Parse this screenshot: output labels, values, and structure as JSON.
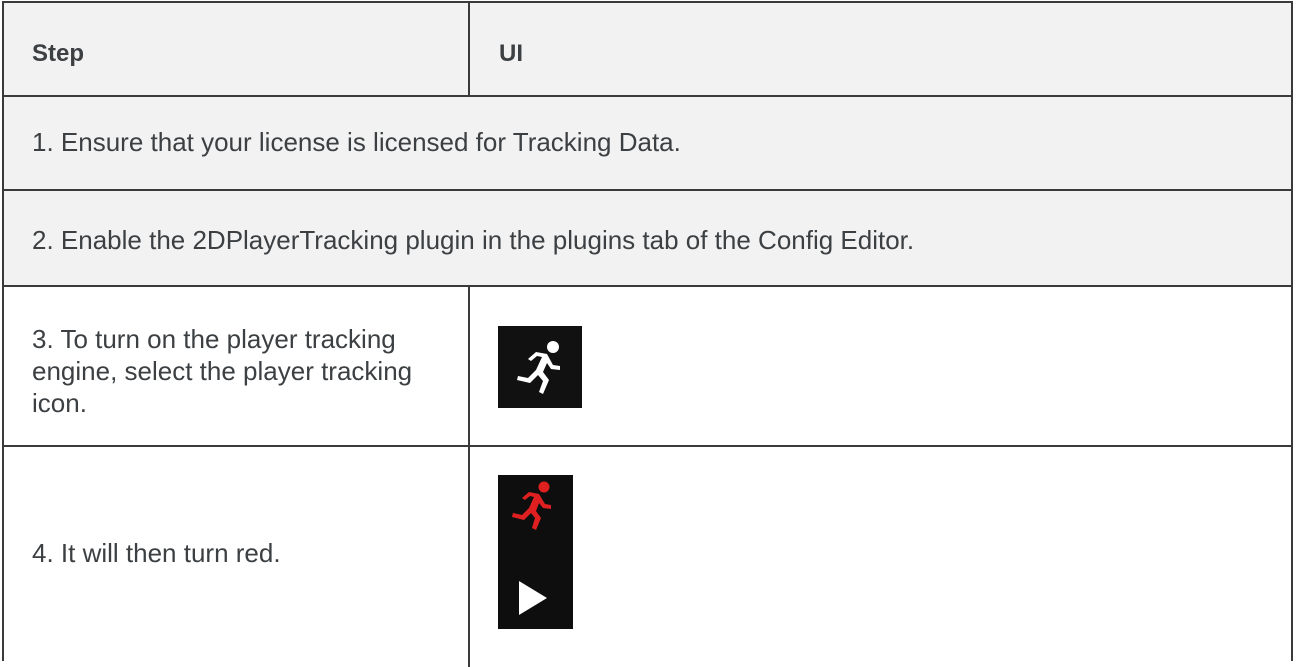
{
  "table": {
    "headers": {
      "step": "Step",
      "ui": "UI"
    },
    "rows": [
      {
        "text": "1. Ensure that your license is licensed for Tracking Data."
      },
      {
        "text": "2. Enable the 2DPlayerTracking plugin in the plugins tab of the Config Editor."
      },
      {
        "step": "3. To turn on the player tracking engine, select the player tracking icon.",
        "ui_icons": [
          "running-person-icon"
        ]
      },
      {
        "step": "4. It will then turn red.",
        "ui_icons": [
          "running-person-red-icon",
          "play-icon"
        ]
      }
    ]
  },
  "colors": {
    "icon_background": "#111111",
    "icon_white": "#ffffff",
    "icon_red": "#e02020",
    "text": "#3c4043",
    "border": "#3a3a3a"
  }
}
